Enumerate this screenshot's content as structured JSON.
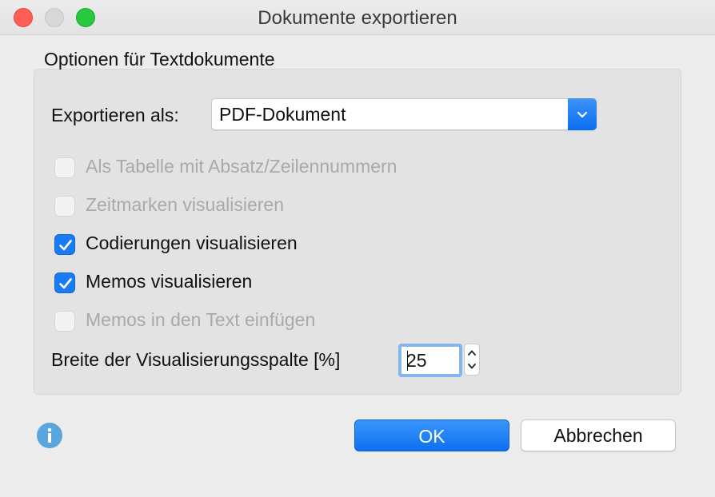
{
  "window": {
    "title": "Dokumente exportieren"
  },
  "group": {
    "label": "Optionen für Textdokumente"
  },
  "export": {
    "label": "Exportieren als:",
    "selected": "PDF-Dokument"
  },
  "options": [
    {
      "label": "Als Tabelle mit Absatz/Zeilennummern",
      "checked": false,
      "enabled": false
    },
    {
      "label": "Zeitmarken visualisieren",
      "checked": false,
      "enabled": false
    },
    {
      "label": "Codierungen visualisieren",
      "checked": true,
      "enabled": true
    },
    {
      "label": "Memos visualisieren",
      "checked": true,
      "enabled": true
    },
    {
      "label": "Memos in den Text einfügen",
      "checked": false,
      "enabled": false
    }
  ],
  "column_width": {
    "label": "Breite der Visualisierungsspalte [%]",
    "value": "25"
  },
  "buttons": {
    "ok": "OK",
    "cancel": "Abbrechen"
  },
  "icons": {
    "info": "info-icon",
    "dropdown": "chevron-updown-icon",
    "stepper": "stepper-icon"
  },
  "colors": {
    "accent": "#0a6ef0",
    "close": "#ff5f57",
    "zoom": "#28c840",
    "info": "#5aa5de"
  }
}
